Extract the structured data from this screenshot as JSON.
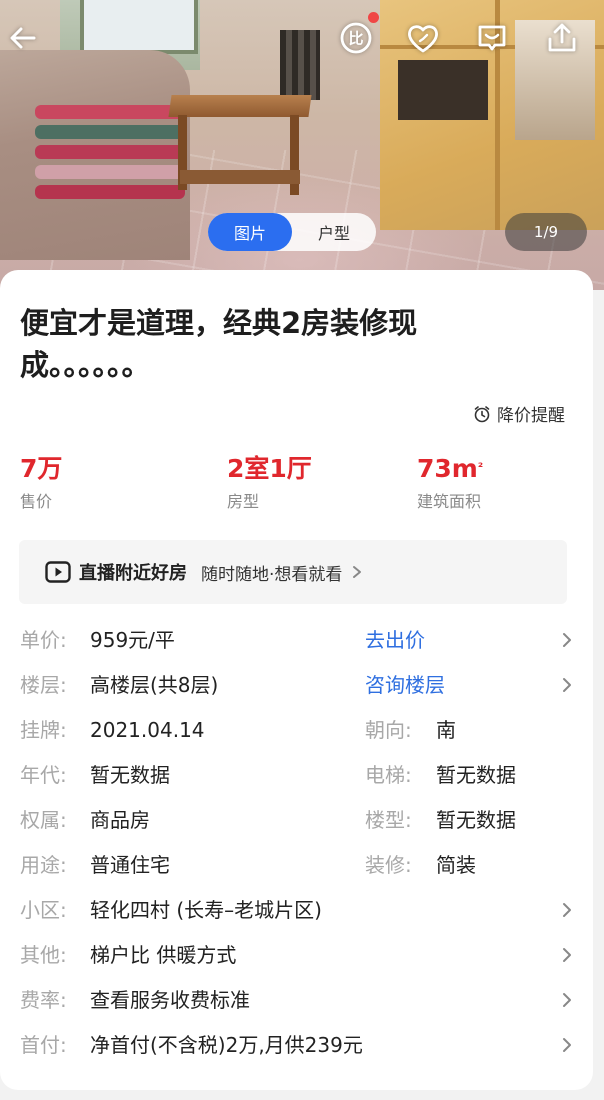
{
  "gallery": {
    "tabs": [
      {
        "label": "图片",
        "active": true
      },
      {
        "label": "户型",
        "active": false
      }
    ],
    "counter": "1/9"
  },
  "topbar": {
    "icons": [
      "back-arrow-icon",
      "compare-icon",
      "favorite-heart-icon",
      "message-icon",
      "share-icon"
    ],
    "compare_badge_color": "#f04646"
  },
  "listing": {
    "title_line1": "便宜才是道理，经典2房装修现",
    "title_line2": "成。。。。。。",
    "price_alert": "降价提醒"
  },
  "stats": [
    {
      "value": "7万",
      "label": "售价"
    },
    {
      "value": "2室1厅",
      "label": "房型"
    },
    {
      "value": "73m",
      "unit_sup": "²",
      "label": "建筑面积"
    }
  ],
  "live": {
    "title": "直播附近好房",
    "subtitle": "随时随地·想看就看"
  },
  "details": {
    "unit_price": {
      "label": "单价:",
      "value": "959元/平",
      "action": "去出价"
    },
    "floor": {
      "label": "楼层:",
      "value": "高楼层(共8层)",
      "action": "咨询楼层"
    },
    "listed": {
      "label": "挂牌:",
      "value": "2021.04.14",
      "label2": "朝向:",
      "value2": "南"
    },
    "year": {
      "label": "年代:",
      "value": "暂无数据",
      "label2": "电梯:",
      "value2": "暂无数据"
    },
    "ownership": {
      "label": "权属:",
      "value": "商品房",
      "label2": "楼型:",
      "value2": "暂无数据"
    },
    "usage": {
      "label": "用途:",
      "value": "普通住宅",
      "label2": "装修:",
      "value2": "简装"
    },
    "community": {
      "label": "小区:",
      "value": "轻化四村 (长寿–老城片区)"
    },
    "other": {
      "label": "其他:",
      "value": "梯户比 供暖方式"
    },
    "fee": {
      "label": "费率:",
      "value": "查看服务收费标准"
    },
    "down_payment": {
      "label": "首付:",
      "value": "净首付(不含税)2万,月供239元"
    }
  },
  "colors": {
    "accent_blue": "#2b6ef0",
    "price_red": "#e0272d",
    "link_blue": "#2f6fe0"
  }
}
